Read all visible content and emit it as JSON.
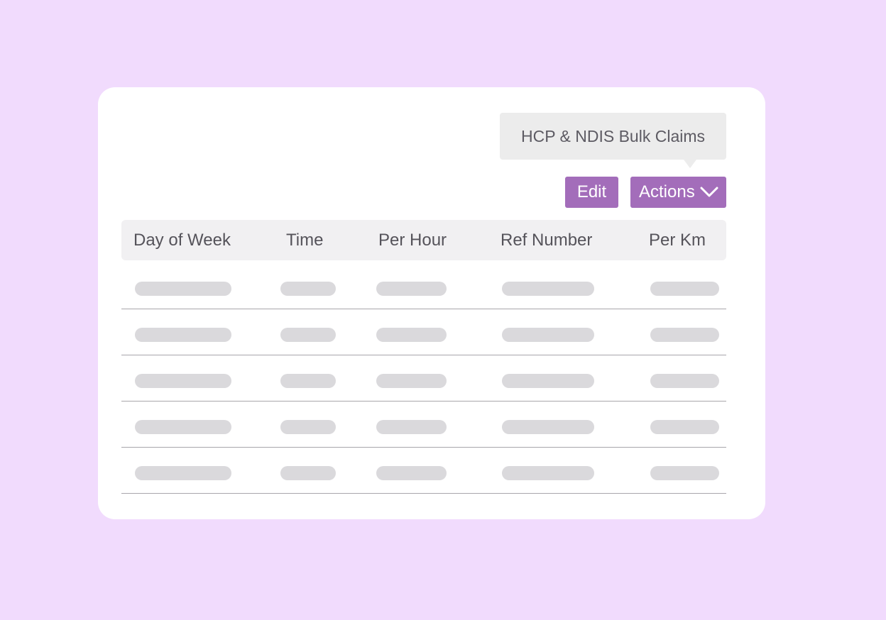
{
  "tooltip": {
    "text": "HCP & NDIS Bulk Claims"
  },
  "toolbar": {
    "edit_label": "Edit",
    "actions_label": "Actions",
    "actions_icon": "chevron-down-icon",
    "button_color": "#a36dba"
  },
  "table": {
    "columns": [
      "Day of Week",
      "Time",
      "Per Hour",
      "Ref Number",
      "Per Km"
    ],
    "rows": [
      [
        "",
        "",
        "",
        "",
        ""
      ],
      [
        "",
        "",
        "",
        "",
        ""
      ],
      [
        "",
        "",
        "",
        "",
        ""
      ],
      [
        "",
        "",
        "",
        "",
        ""
      ],
      [
        "",
        "",
        "",
        "",
        ""
      ]
    ]
  },
  "colors": {
    "background": "#f1dbfd",
    "card": "#ffffff",
    "header": "#f1f0f2",
    "placeholder": "#dad9dc"
  }
}
